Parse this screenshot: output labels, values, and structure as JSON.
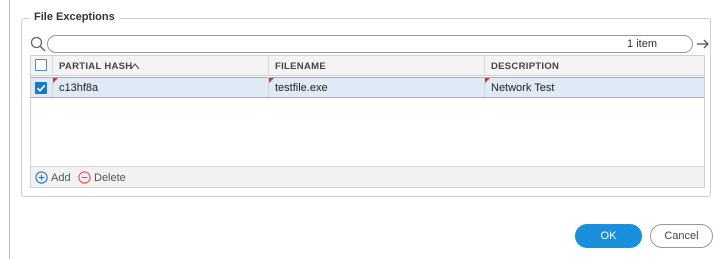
{
  "section": {
    "title": "File Exceptions"
  },
  "search": {
    "value": "",
    "placeholder": "",
    "count_text": "1 item"
  },
  "icons": {
    "search": "search-icon",
    "apply": "arrow-right-icon",
    "clear": "close-icon",
    "add": "plus-circle-icon",
    "delete": "minus-circle-icon"
  },
  "grid": {
    "columns": [
      "PARTIAL HASH",
      "FILENAME",
      "DESCRIPTION"
    ],
    "sort_indicator": "^",
    "rows": [
      {
        "checked": true,
        "partial_hash": "c13hf8a",
        "filename": "testfile.exe",
        "description": "Network Test"
      }
    ]
  },
  "footer": {
    "add_label": "Add",
    "delete_label": "Delete"
  },
  "buttons": {
    "ok_label": "OK",
    "cancel_label": "Cancel"
  },
  "colors": {
    "accent": "#1a8fdc",
    "delete": "#d9534f",
    "selected_row": "#dfeaf6"
  }
}
